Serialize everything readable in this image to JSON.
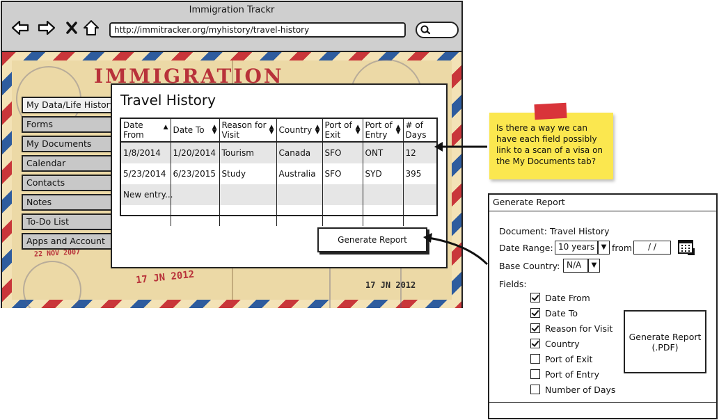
{
  "browser": {
    "title": "Immigration Trackr",
    "url": "http://immitracker.org/myhistory/travel-history"
  },
  "background": {
    "brand": "IMMIGRATION",
    "stamp_dates": [
      "22 NOV 2007",
      "17 JN 2012",
      "17 JN 2012"
    ]
  },
  "sidebar": {
    "items": [
      {
        "label": "My Data/Life History"
      },
      {
        "label": "Forms"
      },
      {
        "label": "My Documents"
      },
      {
        "label": "Calendar"
      },
      {
        "label": "Contacts"
      },
      {
        "label": "Notes"
      },
      {
        "label": "To-Do List"
      },
      {
        "label": "Apps and Account"
      }
    ]
  },
  "panel": {
    "title": "Travel History",
    "columns": [
      {
        "label": "Date From"
      },
      {
        "label": "Date To"
      },
      {
        "label": "Reason for Visit"
      },
      {
        "label": "Country"
      },
      {
        "label": "Port of Exit"
      },
      {
        "label": "Port of Entry"
      },
      {
        "label": "# of Days"
      }
    ],
    "rows": [
      {
        "date_from": "1/8/2014",
        "date_to": "1/20/2014",
        "reason": "Tourism",
        "country": "Canada",
        "port_exit": "SFO",
        "port_entry": "ONT",
        "days": "12"
      },
      {
        "date_from": "5/23/2014",
        "date_to": "6/23/2015",
        "reason": "Study",
        "country": "Australia",
        "port_exit": "SFO",
        "port_entry": "SYD",
        "days": "395"
      }
    ],
    "new_entry": "New entry...",
    "generate_button": "Generate Report"
  },
  "sticky_note": {
    "text": "Is there a way we can have each field possibly link to a scan of a visa on the My Documents tab?"
  },
  "dialog": {
    "title": "Generate Report",
    "document_label": "Document: Travel History",
    "date_range_label": "Date Range:",
    "date_range_value": "10 years",
    "from_label": "from",
    "from_value": "/ /",
    "base_country_label": "Base Country:",
    "base_country_value": "N/A",
    "fields_label": "Fields:",
    "fields": [
      {
        "label": "Date From",
        "checked": true
      },
      {
        "label": "Date To",
        "checked": true
      },
      {
        "label": "Reason for Visit",
        "checked": true
      },
      {
        "label": "Country",
        "checked": true
      },
      {
        "label": "Port of Exit",
        "checked": false
      },
      {
        "label": "Port of Entry",
        "checked": false
      },
      {
        "label": "Number of Days",
        "checked": false
      }
    ],
    "pdf_button_line1": "Generate Report",
    "pdf_button_line2": "(.PDF)"
  }
}
